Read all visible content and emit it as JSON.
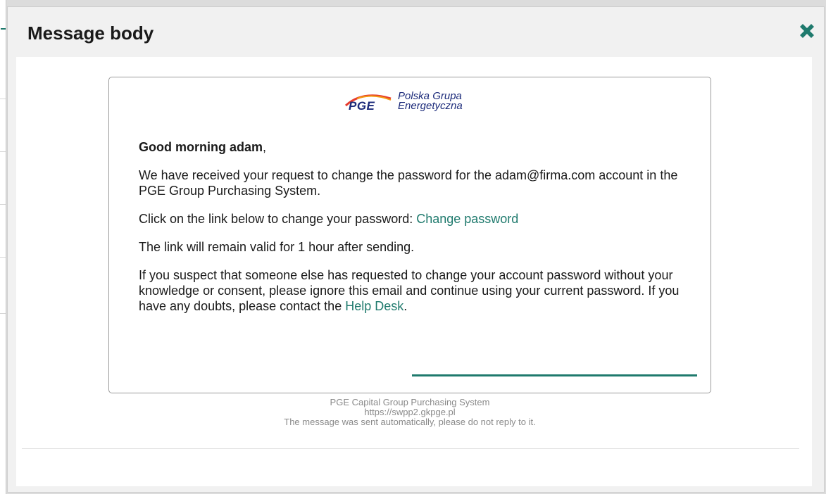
{
  "modal": {
    "title": "Message body",
    "close_icon": "close-icon",
    "accent_color": "#1f7a6d"
  },
  "logo": {
    "mark": "PGE",
    "company_line1": "Polska Grupa",
    "company_line2": "Energetyczna"
  },
  "email": {
    "greeting_prefix": "Good morning adam",
    "greeting_suffix": ",",
    "paragraph1": "We have received your request to change the password for the adam@firma.com account in the PGE Group Purchasing System.",
    "paragraph2_text": "Click on the link below to change your password: ",
    "paragraph2_link": "Change password",
    "paragraph3": "The link will remain valid for 1 hour after sending.",
    "paragraph4_text": "If you suspect that someone else has requested to change your account password without your knowledge or consent, please ignore this email and continue using your current password. If you have any doubts, please contact the ",
    "paragraph4_link": "Help Desk",
    "paragraph4_end": "."
  },
  "footer": {
    "line1": "PGE Capital Group Purchasing System",
    "line2": "https://swpp2.gkpge.pl",
    "line3": "The message was sent automatically, please do not reply to it."
  }
}
